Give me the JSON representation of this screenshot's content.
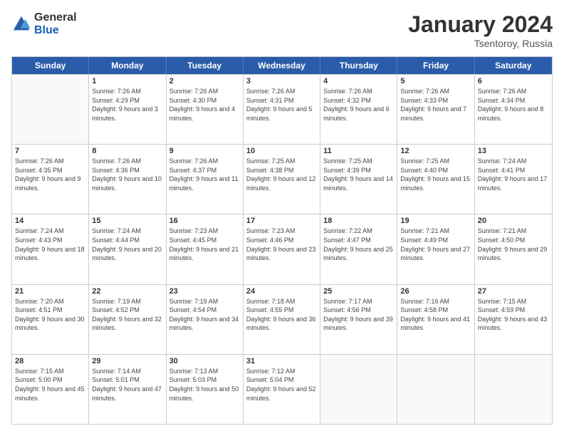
{
  "logo": {
    "general": "General",
    "blue": "Blue"
  },
  "title": {
    "month": "January 2024",
    "location": "Tsentoroy, Russia"
  },
  "weekdays": [
    "Sunday",
    "Monday",
    "Tuesday",
    "Wednesday",
    "Thursday",
    "Friday",
    "Saturday"
  ],
  "weeks": [
    [
      {
        "day": "",
        "sunrise": "",
        "sunset": "",
        "daylight": ""
      },
      {
        "day": "1",
        "sunrise": "Sunrise: 7:26 AM",
        "sunset": "Sunset: 4:29 PM",
        "daylight": "Daylight: 9 hours and 3 minutes."
      },
      {
        "day": "2",
        "sunrise": "Sunrise: 7:26 AM",
        "sunset": "Sunset: 4:30 PM",
        "daylight": "Daylight: 9 hours and 4 minutes."
      },
      {
        "day": "3",
        "sunrise": "Sunrise: 7:26 AM",
        "sunset": "Sunset: 4:31 PM",
        "daylight": "Daylight: 9 hours and 5 minutes."
      },
      {
        "day": "4",
        "sunrise": "Sunrise: 7:26 AM",
        "sunset": "Sunset: 4:32 PM",
        "daylight": "Daylight: 9 hours and 6 minutes."
      },
      {
        "day": "5",
        "sunrise": "Sunrise: 7:26 AM",
        "sunset": "Sunset: 4:33 PM",
        "daylight": "Daylight: 9 hours and 7 minutes."
      },
      {
        "day": "6",
        "sunrise": "Sunrise: 7:26 AM",
        "sunset": "Sunset: 4:34 PM",
        "daylight": "Daylight: 9 hours and 8 minutes."
      }
    ],
    [
      {
        "day": "7",
        "sunrise": "Sunrise: 7:26 AM",
        "sunset": "Sunset: 4:35 PM",
        "daylight": "Daylight: 9 hours and 9 minutes."
      },
      {
        "day": "8",
        "sunrise": "Sunrise: 7:26 AM",
        "sunset": "Sunset: 4:36 PM",
        "daylight": "Daylight: 9 hours and 10 minutes."
      },
      {
        "day": "9",
        "sunrise": "Sunrise: 7:26 AM",
        "sunset": "Sunset: 4:37 PM",
        "daylight": "Daylight: 9 hours and 11 minutes."
      },
      {
        "day": "10",
        "sunrise": "Sunrise: 7:25 AM",
        "sunset": "Sunset: 4:38 PM",
        "daylight": "Daylight: 9 hours and 12 minutes."
      },
      {
        "day": "11",
        "sunrise": "Sunrise: 7:25 AM",
        "sunset": "Sunset: 4:39 PM",
        "daylight": "Daylight: 9 hours and 14 minutes."
      },
      {
        "day": "12",
        "sunrise": "Sunrise: 7:25 AM",
        "sunset": "Sunset: 4:40 PM",
        "daylight": "Daylight: 9 hours and 15 minutes."
      },
      {
        "day": "13",
        "sunrise": "Sunrise: 7:24 AM",
        "sunset": "Sunset: 4:41 PM",
        "daylight": "Daylight: 9 hours and 17 minutes."
      }
    ],
    [
      {
        "day": "14",
        "sunrise": "Sunrise: 7:24 AM",
        "sunset": "Sunset: 4:43 PM",
        "daylight": "Daylight: 9 hours and 18 minutes."
      },
      {
        "day": "15",
        "sunrise": "Sunrise: 7:24 AM",
        "sunset": "Sunset: 4:44 PM",
        "daylight": "Daylight: 9 hours and 20 minutes."
      },
      {
        "day": "16",
        "sunrise": "Sunrise: 7:23 AM",
        "sunset": "Sunset: 4:45 PM",
        "daylight": "Daylight: 9 hours and 21 minutes."
      },
      {
        "day": "17",
        "sunrise": "Sunrise: 7:23 AM",
        "sunset": "Sunset: 4:46 PM",
        "daylight": "Daylight: 9 hours and 23 minutes."
      },
      {
        "day": "18",
        "sunrise": "Sunrise: 7:22 AM",
        "sunset": "Sunset: 4:47 PM",
        "daylight": "Daylight: 9 hours and 25 minutes."
      },
      {
        "day": "19",
        "sunrise": "Sunrise: 7:21 AM",
        "sunset": "Sunset: 4:49 PM",
        "daylight": "Daylight: 9 hours and 27 minutes."
      },
      {
        "day": "20",
        "sunrise": "Sunrise: 7:21 AM",
        "sunset": "Sunset: 4:50 PM",
        "daylight": "Daylight: 9 hours and 29 minutes."
      }
    ],
    [
      {
        "day": "21",
        "sunrise": "Sunrise: 7:20 AM",
        "sunset": "Sunset: 4:51 PM",
        "daylight": "Daylight: 9 hours and 30 minutes."
      },
      {
        "day": "22",
        "sunrise": "Sunrise: 7:19 AM",
        "sunset": "Sunset: 4:52 PM",
        "daylight": "Daylight: 9 hours and 32 minutes."
      },
      {
        "day": "23",
        "sunrise": "Sunrise: 7:19 AM",
        "sunset": "Sunset: 4:54 PM",
        "daylight": "Daylight: 9 hours and 34 minutes."
      },
      {
        "day": "24",
        "sunrise": "Sunrise: 7:18 AM",
        "sunset": "Sunset: 4:55 PM",
        "daylight": "Daylight: 9 hours and 36 minutes."
      },
      {
        "day": "25",
        "sunrise": "Sunrise: 7:17 AM",
        "sunset": "Sunset: 4:56 PM",
        "daylight": "Daylight: 9 hours and 39 minutes."
      },
      {
        "day": "26",
        "sunrise": "Sunrise: 7:16 AM",
        "sunset": "Sunset: 4:58 PM",
        "daylight": "Daylight: 9 hours and 41 minutes."
      },
      {
        "day": "27",
        "sunrise": "Sunrise: 7:15 AM",
        "sunset": "Sunset: 4:59 PM",
        "daylight": "Daylight: 9 hours and 43 minutes."
      }
    ],
    [
      {
        "day": "28",
        "sunrise": "Sunrise: 7:15 AM",
        "sunset": "Sunset: 5:00 PM",
        "daylight": "Daylight: 9 hours and 45 minutes."
      },
      {
        "day": "29",
        "sunrise": "Sunrise: 7:14 AM",
        "sunset": "Sunset: 5:01 PM",
        "daylight": "Daylight: 9 hours and 47 minutes."
      },
      {
        "day": "30",
        "sunrise": "Sunrise: 7:13 AM",
        "sunset": "Sunset: 5:03 PM",
        "daylight": "Daylight: 9 hours and 50 minutes."
      },
      {
        "day": "31",
        "sunrise": "Sunrise: 7:12 AM",
        "sunset": "Sunset: 5:04 PM",
        "daylight": "Daylight: 9 hours and 52 minutes."
      },
      {
        "day": "",
        "sunrise": "",
        "sunset": "",
        "daylight": ""
      },
      {
        "day": "",
        "sunrise": "",
        "sunset": "",
        "daylight": ""
      },
      {
        "day": "",
        "sunrise": "",
        "sunset": "",
        "daylight": ""
      }
    ]
  ]
}
